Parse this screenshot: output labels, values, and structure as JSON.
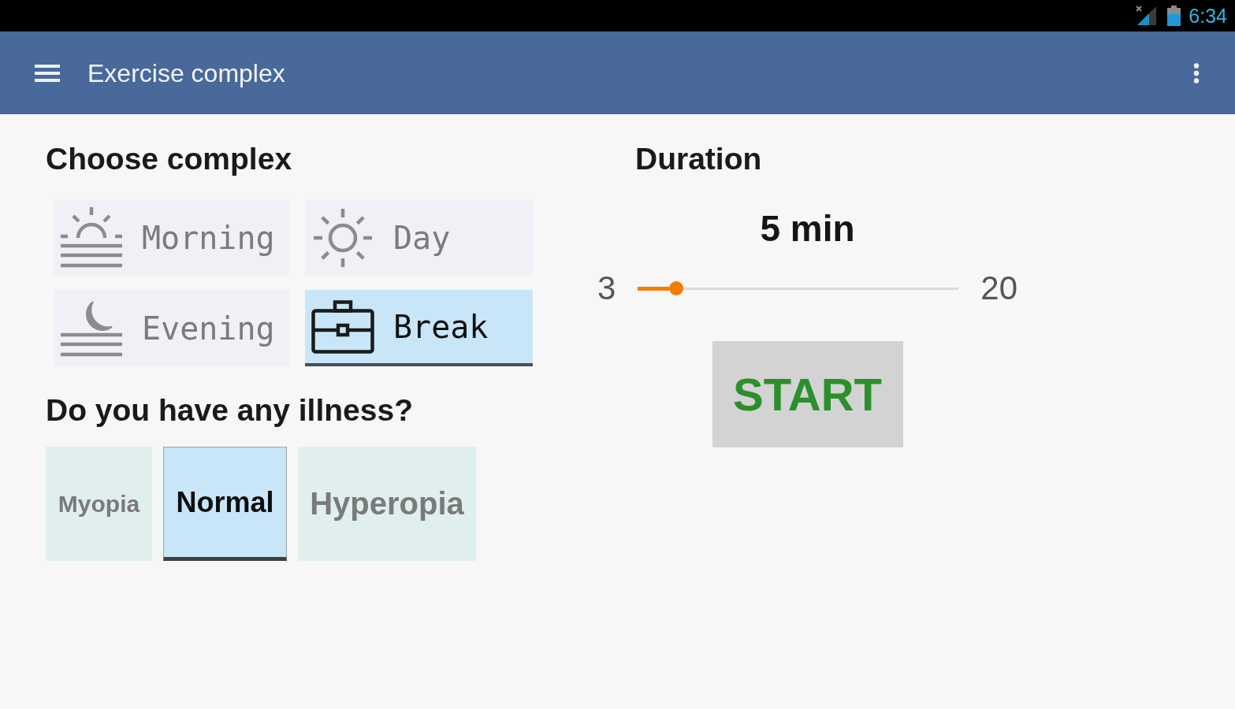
{
  "status_bar": {
    "time": "6:34"
  },
  "app_bar": {
    "title": "Exercise complex"
  },
  "complex": {
    "heading": "Choose complex",
    "options": [
      {
        "label": "Morning",
        "kind": "morning",
        "selected": false
      },
      {
        "label": "Day",
        "kind": "day",
        "selected": false
      },
      {
        "label": "Evening",
        "kind": "evening",
        "selected": false
      },
      {
        "label": "Break",
        "kind": "break",
        "selected": true
      }
    ]
  },
  "illness": {
    "heading": "Do you have any illness?",
    "options": [
      {
        "label": "Myopia",
        "selected": false
      },
      {
        "label": "Normal",
        "selected": true
      },
      {
        "label": "Hyperopia",
        "selected": false
      }
    ]
  },
  "duration": {
    "heading": "Duration",
    "value": "5 min",
    "slider": {
      "min_label": "3",
      "max_label": "20",
      "level": 0.12
    },
    "button": "START"
  }
}
